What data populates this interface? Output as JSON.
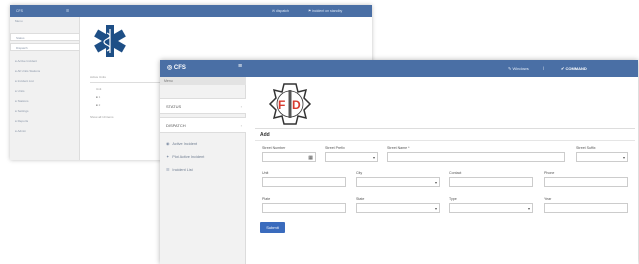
{
  "bg_window": {
    "brand": "CFS",
    "top_right": "⚑ incident on standby",
    "top_mid": "✉ dispatch",
    "menu_label": "Menu",
    "items": [
      "Status",
      "Dispatch",
      "● Active Incident",
      "● All Units Stations",
      "● Incident List",
      "● Units",
      "● Stations",
      "● Settings",
      "● Reports",
      "● Admin"
    ],
    "table_header": "Active Units",
    "table_lines": [
      "Unit",
      "■ 1",
      "■ 2",
      "Show all 10 items"
    ]
  },
  "header": {
    "brand": "CFS",
    "menu_icon": "hamburger-icon",
    "user": "✎ Windows",
    "separator": "|",
    "status": "✔ COMMAND"
  },
  "sidebar": {
    "menu_label": "Menu",
    "status_label": "STATUS",
    "dispatch_label": "DISPATCH",
    "links": [
      {
        "icon": "◉",
        "label": "Active Incident"
      },
      {
        "icon": "✦",
        "label": "Plot Active Incident"
      },
      {
        "icon": "☰",
        "label": "Incident List"
      }
    ]
  },
  "form": {
    "title": "Add",
    "labels": {
      "street_number": "Street Number",
      "street_prefix": "Street Prefix",
      "street_name": "Street Name *",
      "street_suffix": "Street Suffix",
      "unit": "Unit",
      "city": "City",
      "contact": "Contact",
      "phone": "Phone",
      "plate": "Plate",
      "state": "State",
      "type": "Type",
      "year": "Year"
    },
    "values": {
      "street_number": "",
      "street_prefix": "",
      "street_name": "",
      "street_suffix": "",
      "unit": "",
      "city": "",
      "contact": "",
      "phone": "",
      "plate": "",
      "state": "",
      "type": "",
      "year": ""
    },
    "submit_label": "Submit"
  },
  "logo": {
    "text": "FD"
  },
  "colors": {
    "topbar": "#4a6fa5",
    "submit": "#3a6bbd",
    "logo_red": "#d73a2e"
  }
}
